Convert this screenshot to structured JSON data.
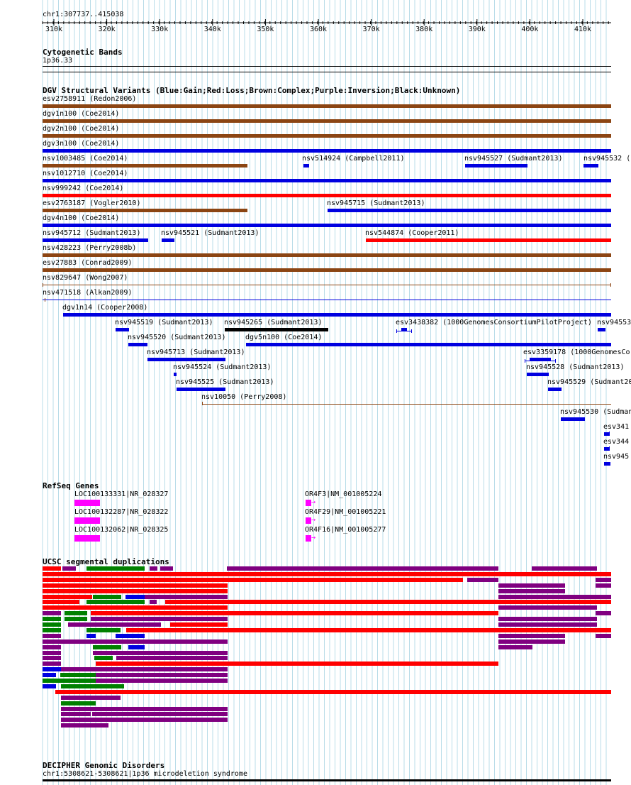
{
  "header": {
    "region": "chr1:307737..415038",
    "ticks": [
      "310k",
      "320k",
      "330k",
      "340k",
      "350k",
      "360k",
      "370k",
      "380k",
      "390k",
      "400k",
      "410k"
    ]
  },
  "cytobands": {
    "title": "Cytogenetic Bands",
    "band": "1p36.33"
  },
  "dgv": {
    "title": "DGV Structural Variants (Blue:Gain;Red:Loss;Brown:Complex;Purple:Inversion;Black:Unknown)",
    "colors": {
      "gain": "#0000e0",
      "loss": "#ff0000",
      "complex": "#8b4513",
      "inversion": "#800080",
      "unknown": "#000000"
    },
    "labels": [
      "esv2758911 (Redon2006)",
      "dgv1n100 (Coe2014)",
      "dgv2n100 (Coe2014)",
      "dgv3n100 (Coe2014)",
      "nsv1003485 (Coe2014)",
      "nsv514924 (Campbell2011)",
      "nsv945527 (Sudmant2013)",
      "nsv945532 (",
      "nsv1012710 (Coe2014)",
      "nsv999242 (Coe2014)",
      "esv2763187 (Vogler2010)",
      "nsv945715 (Sudmant2013)",
      "dgv4n100 (Coe2014)",
      "nsv945712 (Sudmant2013)",
      "nsv945521 (Sudmant2013)",
      "nsv544874 (Cooper2011)",
      "nsv428223 (Perry2008b)",
      "esv27883 (Conrad2009)",
      "nsv829647 (Wong2007)",
      "nsv471518 (Alkan2009)",
      "dgv1n14 (Cooper2008)",
      "nsv945519 (Sudmant2013)",
      "nsv945265 (Sudmant2013)",
      "esv3438382 (1000GenomesConsortiumPilotProject)",
      "nsv94553",
      "nsv945520 (Sudmant2013)",
      "dgv5n100 (Coe2014)",
      "nsv945713 (Sudmant2013)",
      "esv3359178 (1000GenomesCo",
      "nsv945524 (Sudmant2013)",
      "nsv945528 (Sudmant2013)",
      "nsv945525 (Sudmant2013)",
      "nsv945529 (Sudmant20",
      "nsv10050 (Perry2008)",
      "nsv945530 (Sudman",
      "esv341",
      "esv344",
      "nsv945"
    ]
  },
  "refseq": {
    "title": "RefSeq Genes",
    "color": "#ff00ff",
    "genes": [
      "LOC100133331|NR_028327",
      "LOC100132287|NR_028322",
      "LOC100132062|NR_028325",
      "OR4F3|NM_001005224",
      "OR4F29|NM_001005221",
      "OR4F16|NM_001005277"
    ]
  },
  "segdups": {
    "title": "UCSC segmental duplications",
    "colors": {
      "red": "#ff0000",
      "purple": "#800080",
      "green": "#008000",
      "blue": "#0000e0"
    }
  },
  "decipher": {
    "title": "DECIPHER Genomic Disorders",
    "item": "chr1:5308621-5308621|1p36 microdeletion syndrome"
  }
}
